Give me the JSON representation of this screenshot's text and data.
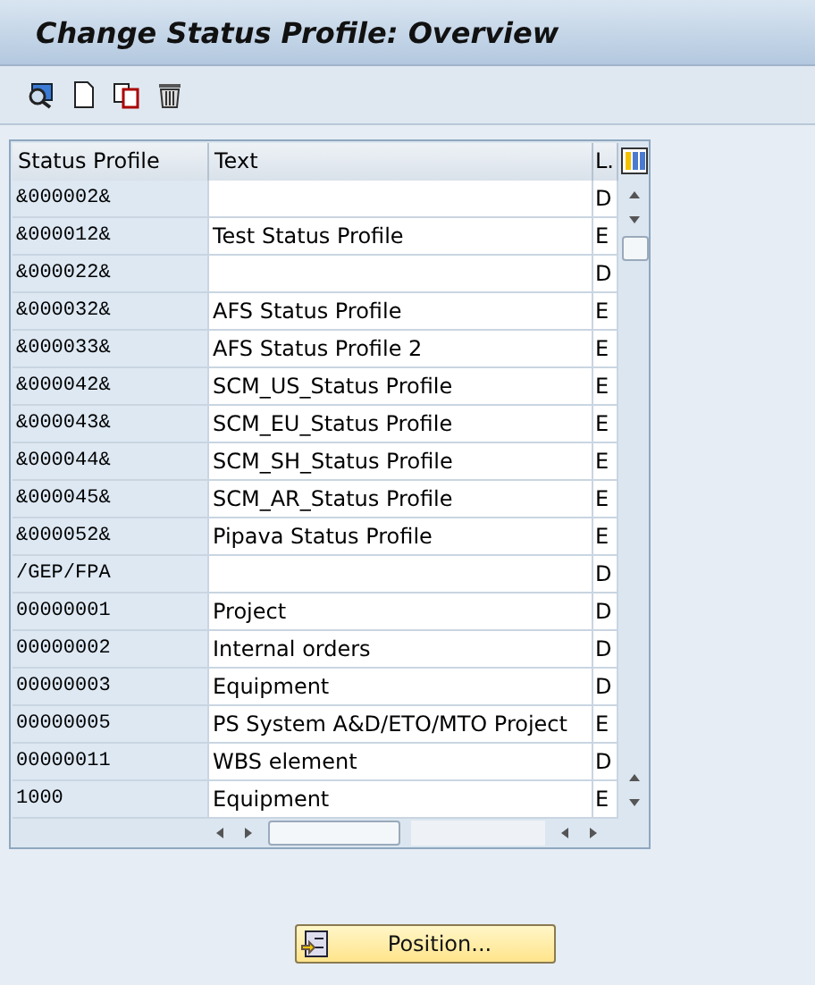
{
  "window": {
    "title": "Change Status Profile: Overview"
  },
  "table": {
    "columns": [
      "Status Profile",
      "Text",
      "L."
    ],
    "rows": [
      [
        "&000002&",
        "",
        "D"
      ],
      [
        "&000012&",
        "Test Status Profile",
        "E"
      ],
      [
        "&000022&",
        "",
        "D"
      ],
      [
        "&000032&",
        "AFS Status Profile",
        "E"
      ],
      [
        "&000033&",
        "AFS Status Profile 2",
        "E"
      ],
      [
        "&000042&",
        "SCM_US_Status Profile",
        "E"
      ],
      [
        "&000043&",
        "SCM_EU_Status Profile",
        "E"
      ],
      [
        "&000044&",
        "SCM_SH_Status Profile",
        "E"
      ],
      [
        "&000045&",
        "SCM_AR_Status Profile",
        "E"
      ],
      [
        "&000052&",
        "Pipava Status Profile",
        "E"
      ],
      [
        "/GEP/FPA",
        "",
        "D"
      ],
      [
        "00000001",
        "Project",
        "D"
      ],
      [
        "00000002",
        "Internal orders",
        "D"
      ],
      [
        "00000003",
        "Equipment",
        "D"
      ],
      [
        "00000005",
        "PS System A&D/ETO/MTO Project",
        "E"
      ],
      [
        "00000011",
        "WBS element",
        "D"
      ],
      [
        "1000",
        "Equipment",
        "E"
      ]
    ]
  },
  "buttons": [
    "Position..."
  ]
}
